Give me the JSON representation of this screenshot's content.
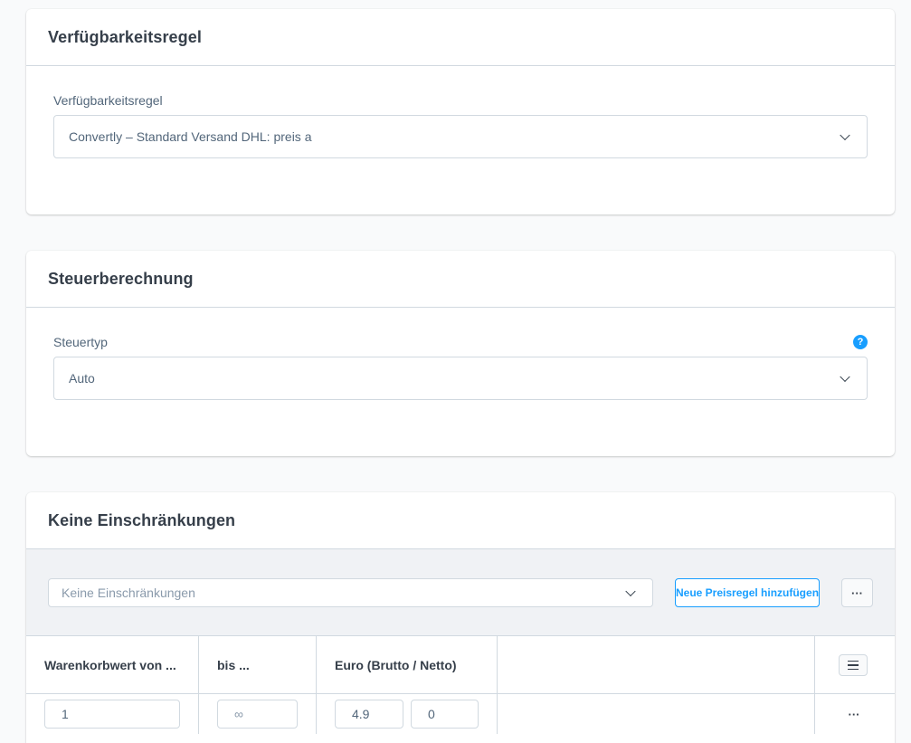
{
  "availability_card": {
    "title": "Verfügbarkeitsregel",
    "field_label": "Verfügbarkeitsregel",
    "selected_value": "Convertly – Standard Versand DHL: preis a"
  },
  "tax_card": {
    "title": "Steuerberechnung",
    "field_label": "Steuertyp",
    "help_glyph": "?",
    "selected_value": "Auto"
  },
  "prices_card": {
    "title": "Keine Einschränkungen",
    "rule_select_value": "Keine Einschränkungen",
    "add_rule_button": "Neue Preisregel hinzufügen",
    "more_glyph": "···",
    "columns": {
      "from": "Warenkorbwert von ...",
      "to": "bis ...",
      "price": "Euro (Brutto / Netto)"
    },
    "rows": [
      {
        "from": "1",
        "to": "∞",
        "gross": "4.9",
        "net": "0",
        "more_glyph": "···"
      }
    ]
  },
  "colors": {
    "accent": "#189eff",
    "border": "#d1d9e0",
    "heading": "#363f4a",
    "text": "#52667a",
    "page_bg": "#f9fafb",
    "toolbar_bg": "#f0f2f5"
  },
  "icons": {
    "select_chevron": "chevron-down-icon",
    "help": "question-circle-icon",
    "more": "more-horizontal-icon",
    "column_settings": "list-icon"
  }
}
